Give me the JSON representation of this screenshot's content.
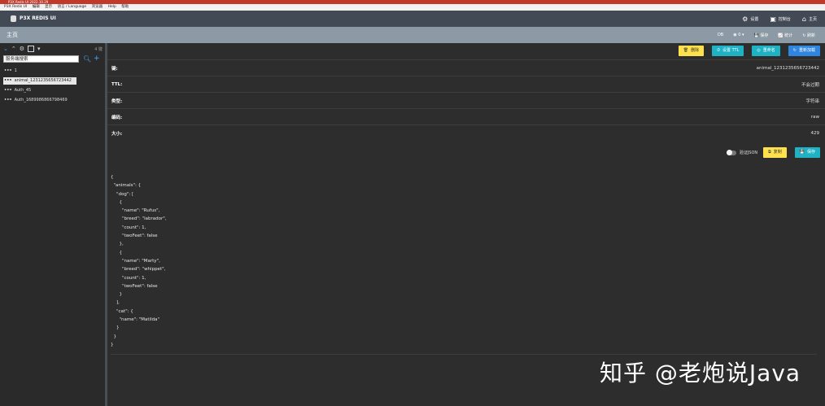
{
  "titlebar": {
    "text": "P3X Redis UI 2022.10.29"
  },
  "menu": {
    "items": [
      "P3X Redis UI",
      "编辑",
      "显示",
      "语言 / Language",
      "浏览器",
      "Help",
      "帮助"
    ]
  },
  "header": {
    "app_name": "P3X REDIS UI",
    "nav": [
      {
        "icon": "gear-icon",
        "label": "设置"
      },
      {
        "icon": "console-icon",
        "label": "控制台"
      },
      {
        "icon": "home-icon",
        "label": "主页"
      }
    ]
  },
  "toolbar": {
    "home": "主页",
    "db_label": "DB",
    "db_value": "0",
    "save": "保存",
    "stats": "统计",
    "refresh": "刷新"
  },
  "sidebar": {
    "key_count": "4 键",
    "search_placeholder": "服务端搜索",
    "keys": [
      "1",
      "animal_1231235656723442",
      "Auth_45",
      "Auth_1689986866798469"
    ]
  },
  "actions": [
    {
      "label": "删除",
      "color": "#ffe14d"
    },
    {
      "label": "设置 TTL",
      "color": "#1fb2c4"
    },
    {
      "label": "重命名",
      "color": "#1fb2c4"
    },
    {
      "label": "重新加载",
      "color": "#2f86e0"
    }
  ],
  "info": [
    {
      "label": "键:",
      "value": "animal_1231235656723442"
    },
    {
      "label": "TTL:",
      "value": "不会过期"
    },
    {
      "label": "类型:",
      "value": "字符串"
    },
    {
      "label": "编码:",
      "value": "raw"
    },
    {
      "label": "大小:",
      "value": "429"
    }
  ],
  "editor_options": {
    "validate_json": "验证JSON",
    "copy": "复制",
    "save": "保存"
  },
  "json_lines": [
    "{",
    "  \"animals\": {",
    "    \"dog\": [",
    "      {",
    "        \"name\": \"Rufus\",",
    "        \"breed\": \"labrador\",",
    "        \"count\": 1,",
    "        \"twoFeet\": false",
    "      },",
    "      {",
    "        \"name\": \"Marty\",",
    "        \"breed\": \"whippet\",",
    "        \"count\": 1,",
    "        \"twoFeet\": false",
    "      }",
    "    ],",
    "    \"cat\": {",
    "      \"name\": \"Matilda\"",
    "    }",
    "  }",
    "}"
  ],
  "watermark": "知乎 @老炮说Java"
}
